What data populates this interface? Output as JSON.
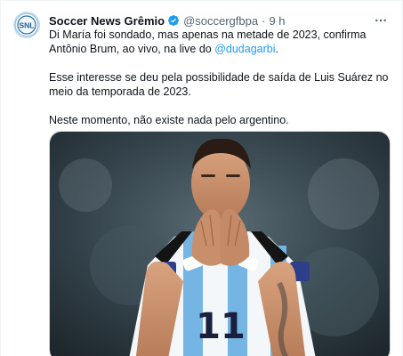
{
  "tweet": {
    "author": {
      "display_name": "Soccer News Grêmio",
      "handle": "@soccergfbpa",
      "avatar_icon": "snl-logo-avatar",
      "verified_icon": "verified-badge-icon",
      "verified_color": "#1d9bf0"
    },
    "separator": "·",
    "time": "9 h",
    "more_icon": "more-options-icon",
    "text": {
      "p1_before": "Di María foi sondado, mas apenas na metade de 2023, confirma Antônio Brum, ao vivo, na live do ",
      "p1_mention": "@dudagarbi",
      "p1_after": ".",
      "p2": "Esse interesse se deu pela possibilidade de saída de Luis Suárez no meio da temporada de 2023.",
      "p3": "Neste momento, não existe nada pelo argentino."
    },
    "media": {
      "jersey_number": "11"
    }
  }
}
